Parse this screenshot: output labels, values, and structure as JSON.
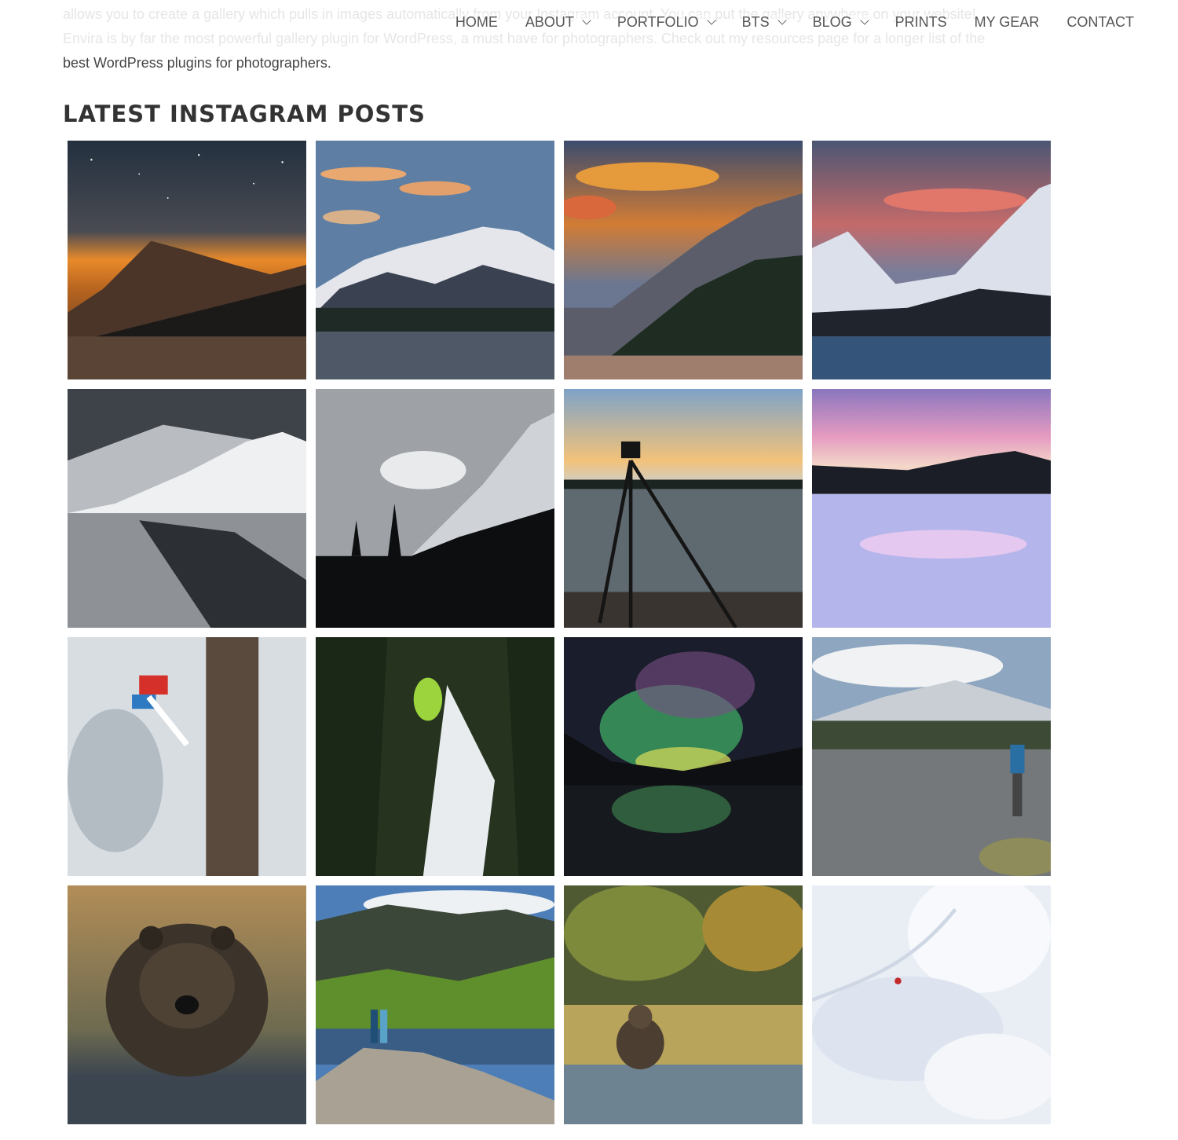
{
  "intro": {
    "line1": "allows you to create a gallery which pulls in images automatically from your Instagram account. You can put the gallery anywhere on your website!",
    "line2": "Envira is by far the most powerful gallery plugin for WordPress, a must have for photographers. Check out my resources page for a longer list of the",
    "line3": "best WordPress plugins for photographers."
  },
  "nav": {
    "items": [
      {
        "label": "HOME",
        "dropdown": false
      },
      {
        "label": "ABOUT",
        "dropdown": true
      },
      {
        "label": "PORTFOLIO",
        "dropdown": true
      },
      {
        "label": "BTS",
        "dropdown": true
      },
      {
        "label": "BLOG",
        "dropdown": true
      },
      {
        "label": "PRINTS",
        "dropdown": false
      },
      {
        "label": "MY GEAR",
        "dropdown": false
      },
      {
        "label": "CONTACT",
        "dropdown": false
      }
    ]
  },
  "section": {
    "title": "LATEST INSTAGRAM POSTS"
  },
  "gallery": {
    "photos": [
      {
        "subject": "night mountain over lake with orange glow and stars"
      },
      {
        "subject": "snowy peak above lake with blue sky and orange clouds"
      },
      {
        "subject": "sunset clouds above forested mountain slope"
      },
      {
        "subject": "pink sunset sky over snowy mountains and lake"
      },
      {
        "subject": "black and white mountain reflection in lake"
      },
      {
        "subject": "black and white peak with lenticular cloud and trees"
      },
      {
        "subject": "camera on tripod at lakeshore at sunset"
      },
      {
        "subject": "pink twilight over frozen snowy lake"
      },
      {
        "subject": "skier in red jacket jumping past snowy tree"
      },
      {
        "subject": "skier in green suit jumping between pine trees"
      },
      {
        "subject": "green aurora reflected in dark lake"
      },
      {
        "subject": "hiker on rock by alpine lake under cloudy peaks"
      },
      {
        "subject": "grizzly bear sitting in water"
      },
      {
        "subject": "couple on rocks overlooking alpine lake and valley"
      },
      {
        "subject": "bear walking through stream by autumn trees"
      },
      {
        "subject": "skier descending large snowy slope"
      }
    ]
  }
}
